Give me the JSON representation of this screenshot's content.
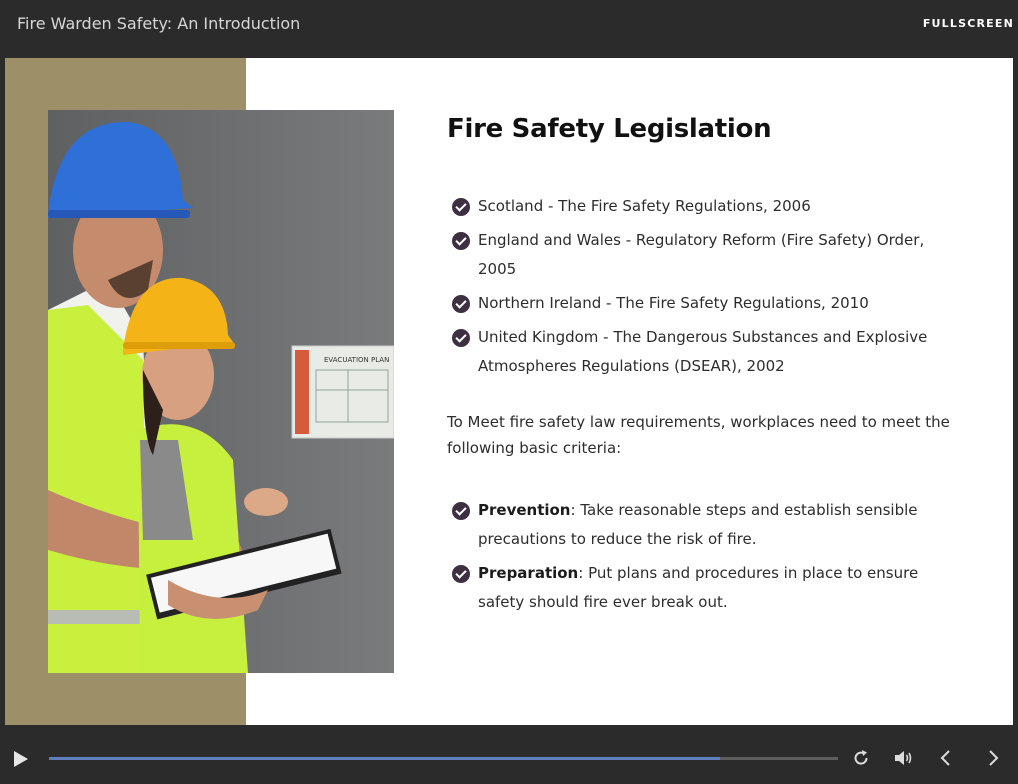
{
  "header": {
    "course_title": "Fire Warden Safety: An Introduction",
    "fullscreen_label": "FULLSCREEN"
  },
  "slide": {
    "heading": "Fire Safety Legislation",
    "legislation": [
      "Scotland - The Fire Safety Regulations, 2006",
      "England and Wales - Regulatory Reform (Fire Safety) Order, 2005",
      "Northern Ireland - The Fire Safety Regulations, 2010",
      "United Kingdom - The Dangerous Substances and Explosive Atmospheres Regulations (DSEAR), 2002"
    ],
    "paragraph": "To Meet fire safety law requirements, workplaces need to meet the following basic criteria:",
    "criteria": [
      {
        "term": "Prevention",
        "text": ": Take reasonable steps and establish sensible precautions to reduce the risk of fire."
      },
      {
        "term": "Preparation",
        "text": ": Put plans and procedures in place to ensure safety should fire ever break out."
      }
    ],
    "photo": {
      "sign_text": "EVACUATION PLAN"
    }
  },
  "player": {
    "progress": 0.85
  },
  "colors": {
    "accent_panel": "#9d9068",
    "check_icon": "#3d3141",
    "progress_fill": "#5f7ebd"
  },
  "icons": {
    "play": "play-icon",
    "replay": "replay-icon",
    "volume": "volume-icon",
    "prev": "chevron-left-icon",
    "next": "chevron-right-icon",
    "check": "check-circle-icon"
  }
}
